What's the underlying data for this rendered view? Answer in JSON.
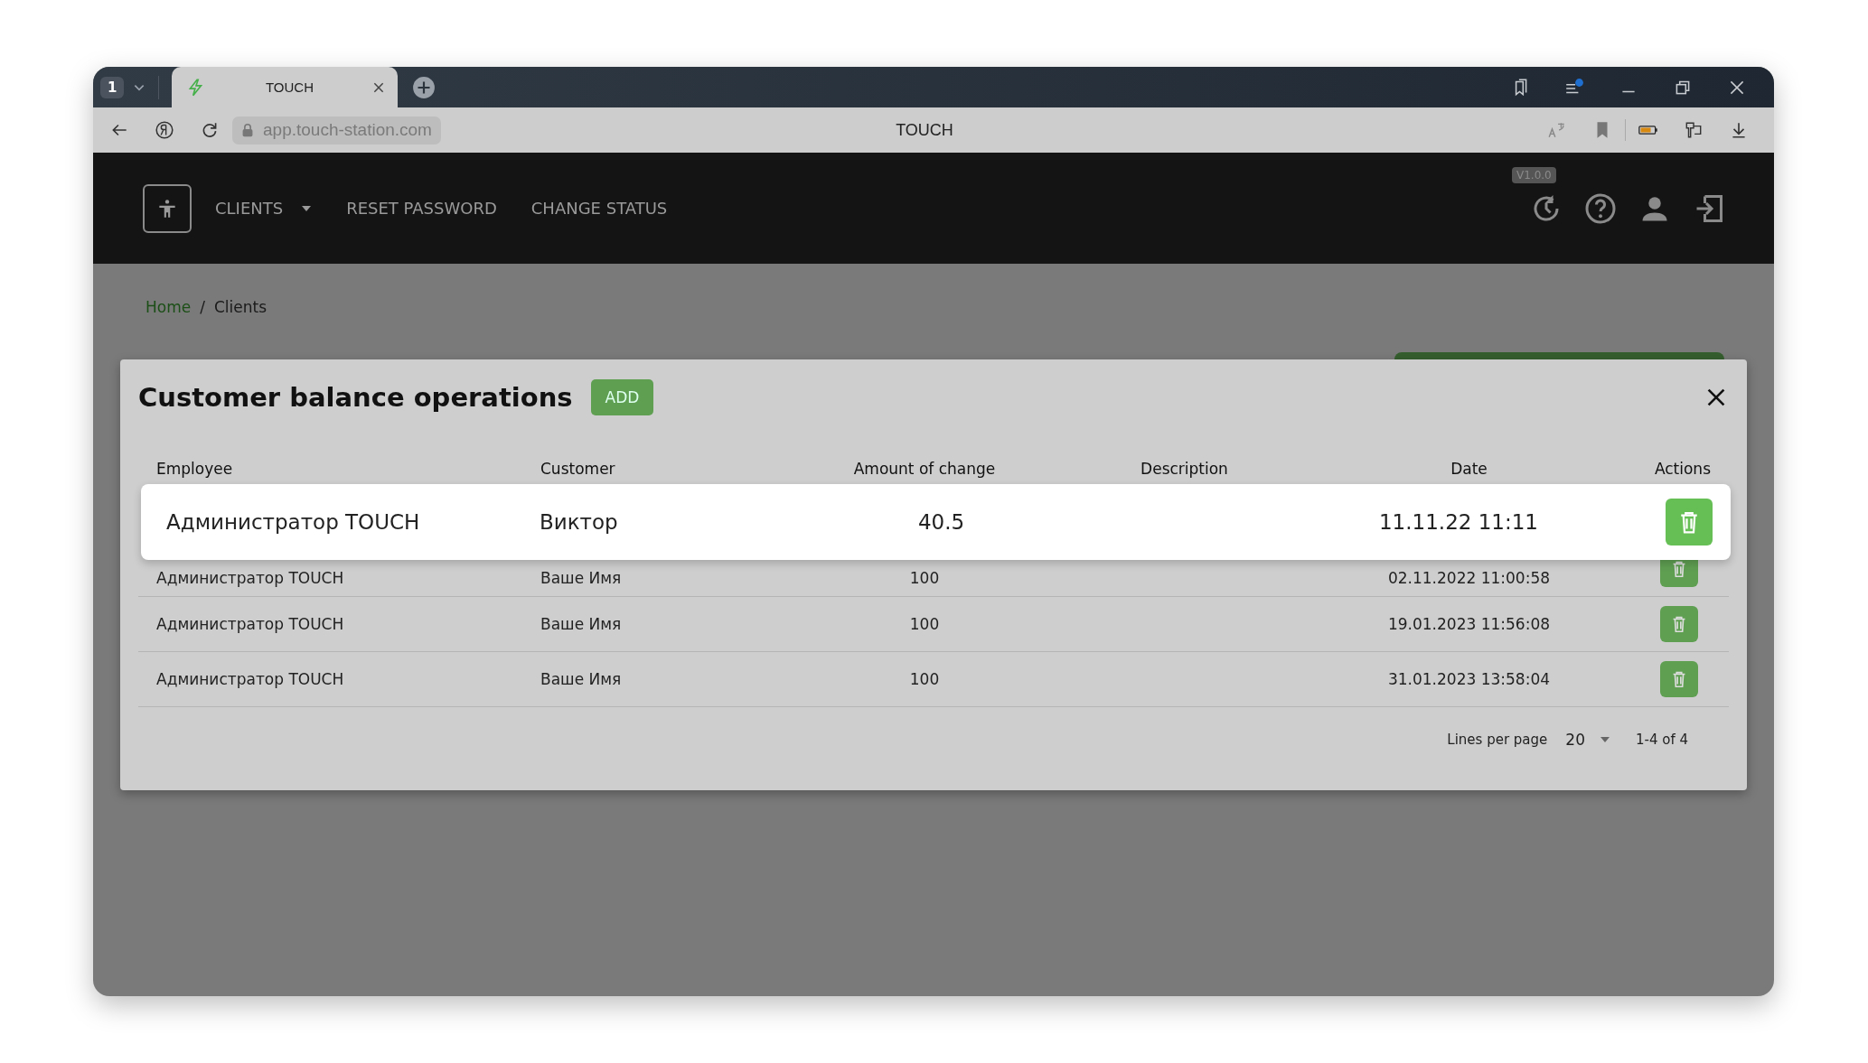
{
  "browser": {
    "tab_count": "1",
    "tabs": [
      {
        "title": "TOUCH",
        "selected": true
      }
    ],
    "address": "app.touch-station.com",
    "page_title": "TOUCH"
  },
  "header": {
    "nav": [
      {
        "label": "CLIENTS",
        "kind": "dropdown"
      },
      {
        "label": "RESET PASSWORD",
        "kind": "link"
      },
      {
        "label": "CHANGE STATUS",
        "kind": "link"
      }
    ],
    "version": "V1.0.0"
  },
  "breadcrumb": {
    "items": [
      {
        "label": "Home",
        "kind": "link"
      },
      {
        "label": "Clients",
        "kind": "current"
      }
    ],
    "separator": "/"
  },
  "modal": {
    "title": "Customer balance operations",
    "add_button": "ADD",
    "columns": [
      "Employee",
      "Customer",
      "Amount of change",
      "Description",
      "Date",
      "Actions"
    ],
    "highlighted_row": {
      "employee": "Администратор TOUCH",
      "customer": "Виктор",
      "amount": "40.5",
      "date": "11.11.22 11:11"
    },
    "rows": [
      {
        "employee": "Администратор TOUCH",
        "customer": "Ваше Имя",
        "amount": "100",
        "date": "02.11.2022 11:00:58"
      },
      {
        "employee": "Администратор TOUCH",
        "customer": "Ваше Имя",
        "amount": "100",
        "date": "19.01.2023 11:56:08"
      },
      {
        "employee": "Администратор TOUCH",
        "customer": "Ваше Имя",
        "amount": "100",
        "date": "31.01.2023 13:58:04"
      }
    ],
    "footer": {
      "lines_per_page_label": "Lines per page",
      "lines_per_page": "20",
      "range": "1-4 of 4"
    }
  }
}
